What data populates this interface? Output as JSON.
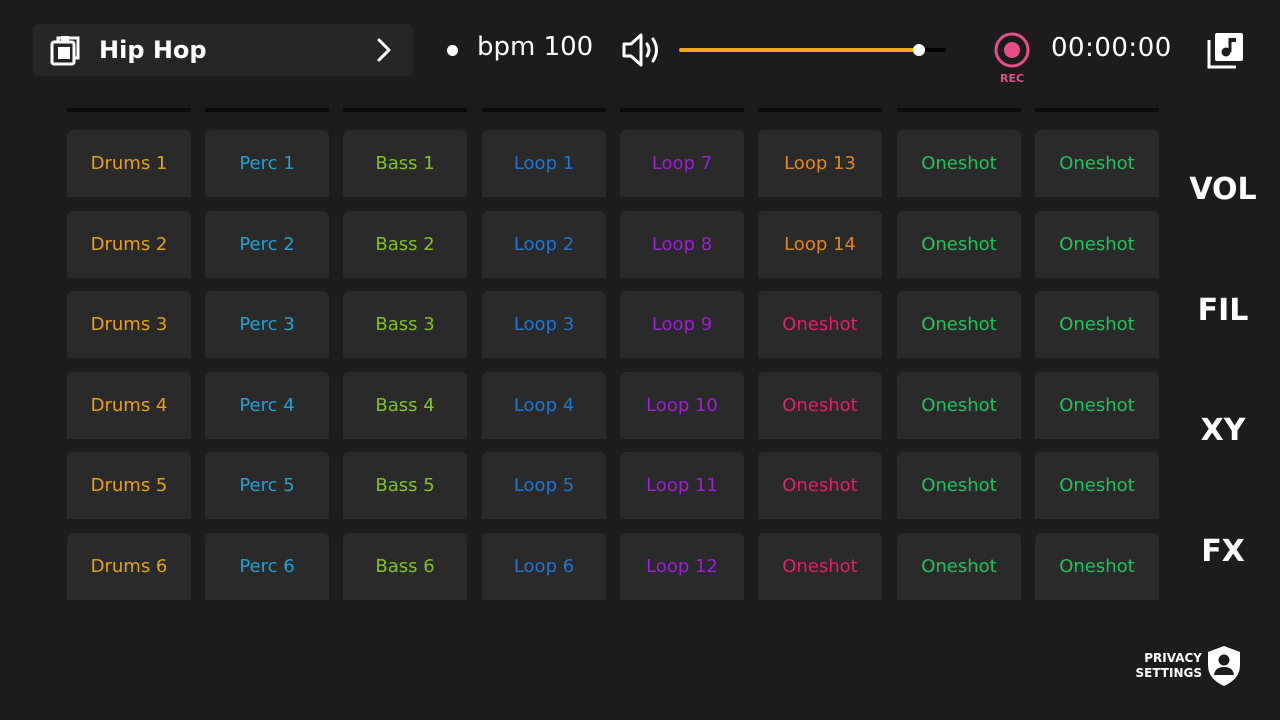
{
  "header": {
    "preset_name": "Hip Hop",
    "bpm_label": "bpm 100",
    "volume_level": 0.9,
    "rec_label": "REC",
    "timer": "00:00:00"
  },
  "colors": {
    "drums": "#e6a219",
    "perc": "#1fa3d9",
    "bass": "#7fc51f",
    "loop_blue": "#1f78d9",
    "loop_purple": "#a01fd9",
    "loop_orange": "#e6851f",
    "oneshot_pink": "#e61f6e",
    "oneshot_green": "#1fc55a",
    "accent": "#f3a81c",
    "rec": "#e64d8a"
  },
  "pads": [
    [
      "Drums 1",
      "Perc 1",
      "Bass 1",
      "Loop 1",
      "Loop 7",
      "Loop 13",
      "Oneshot",
      "Oneshot"
    ],
    [
      "Drums 2",
      "Perc 2",
      "Bass 2",
      "Loop 2",
      "Loop 8",
      "Loop 14",
      "Oneshot",
      "Oneshot"
    ],
    [
      "Drums 3",
      "Perc 3",
      "Bass 3",
      "Loop 3",
      "Loop 9",
      "Oneshot",
      "Oneshot",
      "Oneshot"
    ],
    [
      "Drums 4",
      "Perc 4",
      "Bass 4",
      "Loop 4",
      "Loop 10",
      "Oneshot",
      "Oneshot",
      "Oneshot"
    ],
    [
      "Drums 5",
      "Perc 5",
      "Bass 5",
      "Loop 5",
      "Loop 11",
      "Oneshot",
      "Oneshot",
      "Oneshot"
    ],
    [
      "Drums 6",
      "Perc 6",
      "Bass 6",
      "Loop 6",
      "Loop 12",
      "Oneshot",
      "Oneshot",
      "Oneshot"
    ]
  ],
  "pad_colors": [
    [
      "drums",
      "perc",
      "bass",
      "loop_blue",
      "loop_purple",
      "loop_orange",
      "oneshot_green",
      "oneshot_green"
    ],
    [
      "drums",
      "perc",
      "bass",
      "loop_blue",
      "loop_purple",
      "loop_orange",
      "oneshot_green",
      "oneshot_green"
    ],
    [
      "drums",
      "perc",
      "bass",
      "loop_blue",
      "loop_purple",
      "oneshot_pink",
      "oneshot_green",
      "oneshot_green"
    ],
    [
      "drums",
      "perc",
      "bass",
      "loop_blue",
      "loop_purple",
      "oneshot_pink",
      "oneshot_green",
      "oneshot_green"
    ],
    [
      "drums",
      "perc",
      "bass",
      "loop_blue",
      "loop_purple",
      "oneshot_pink",
      "oneshot_green",
      "oneshot_green"
    ],
    [
      "drums",
      "perc",
      "bass",
      "loop_blue",
      "loop_purple",
      "oneshot_pink",
      "oneshot_green",
      "oneshot_green"
    ]
  ],
  "side_buttons": [
    "VOL",
    "FIL",
    "XY",
    "FX"
  ],
  "privacy": {
    "line1": "PRIVACY",
    "line2": "SETTINGS"
  },
  "icons": {
    "preset": "folder-music-icon",
    "chevron": "chevron-right-icon",
    "speaker": "speaker-icon",
    "record": "record-icon",
    "library": "music-library-icon",
    "privacy": "shield-user-icon"
  }
}
